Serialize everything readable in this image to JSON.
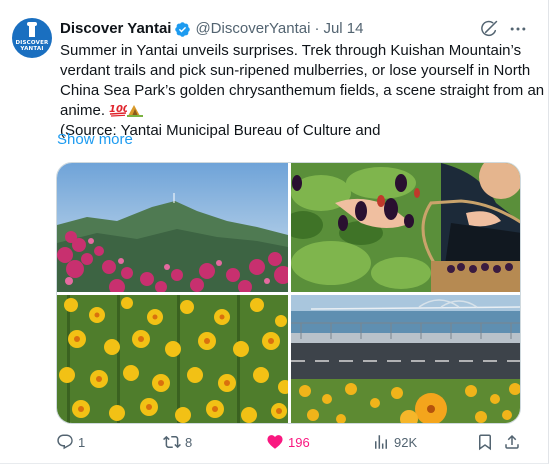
{
  "account": {
    "display_name": "Discover Yantai",
    "handle": "@DiscoverYantai",
    "separator": "·",
    "date": "Jul 14",
    "avatar_text_1": "DISCOVER",
    "avatar_text_2": "YANTAI",
    "verified_color": "#1d9bf0"
  },
  "tweet": {
    "lines": [
      "Summer in Yantai unveils surprises. Trek through Kuishan Mountain’s",
      "verdant trails and pick sun-ripened mulberries, or lose yourself in North",
      "China Sea Park’s golden chrysanthemum fields, a scene straight from an",
      "anime. "
    ],
    "emojis": [
      "hundred-points-emoji",
      "mountain-camp-emoji"
    ],
    "source_line": " (Source: Yantai Municipal Bureau of Culture and",
    "show_more": "Show more"
  },
  "media": {
    "images": [
      "mountain-with-pink-flowers",
      "hand-picking-mulberries",
      "yellow-coreopsis-field",
      "seaside-bridge-road-flowers"
    ]
  },
  "actions": {
    "reply_count": "1",
    "retweet_count": "8",
    "like_count": "196",
    "views_count": "92K",
    "like_color": "#f91880",
    "icon_color": "#536471",
    "icons": [
      "reply-icon",
      "retweet-icon",
      "like-icon",
      "views-icon",
      "bookmark-icon",
      "share-icon"
    ]
  }
}
